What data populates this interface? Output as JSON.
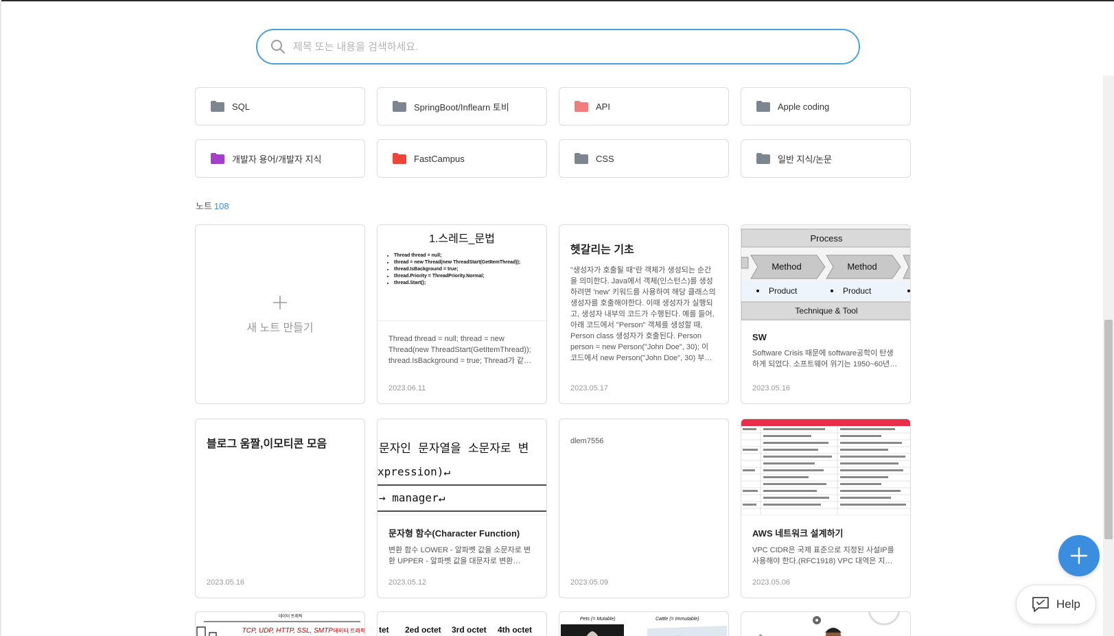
{
  "search": {
    "placeholder": "제목 또는 내용을 검색하세요."
  },
  "folders": [
    {
      "name": "SQL",
      "color": "#7d8590"
    },
    {
      "name": "SpringBoot/Inflearn 토비",
      "color": "#7d8590"
    },
    {
      "name": "API",
      "color": "#f07c7c"
    },
    {
      "name": "Apple coding",
      "color": "#7d8590"
    },
    {
      "name": "개발자 용어/개발자 지식",
      "color": "#a33fc9"
    },
    {
      "name": "FastCampus",
      "color": "#f0433a"
    },
    {
      "name": "CSS",
      "color": "#7d8590"
    },
    {
      "name": "일반 지식/논문",
      "color": "#7d8590"
    }
  ],
  "notes_header": {
    "label": "노트",
    "count": "108"
  },
  "new_note": {
    "label": "새 노트 만들기"
  },
  "notes": [
    {
      "thumb_title": "1.스레드_문법",
      "thumb_lines": [
        "Thread thread = null;",
        "thread = new Thread(new ThreadStart(GetItemThread));",
        "thread.IsBackground = true;",
        "thread.Priority = ThreadPriority.Normal;",
        "thread.Start();"
      ],
      "body": "Thread thread = null; thread = new Thread(new ThreadStart(GetItemThread)); thread.IsBackground = true; Thread가 같은 프로세스 내에서 동작하도록 하는 구문이다.",
      "date": "2023.06.11"
    },
    {
      "title": "헷갈리는 기초",
      "body": "\"생성자가 호출될 때\"란 객체가 생성되는 순간을 의미한다. Java에서 객체(인스턴스)를 생성하려면 'new' 키워드를 사용하여 해당 클래스의 생성자를 호출해야한다. 이때 생성자가 실행되고, 생성자 내부의 코드가 수행된다.  예를 들어, 아래 코드에서 \"Person\" 객체를 생성할 때, Person class 생성자가 호출된다.  Person person = new Person(\"John Doe\", 30); 이 코드에서 new Person(\"John Doe\", 30) 부분은 Person 클래스의 생성자를 호출하면서 인자로 \"John Doe\"와 30을 전달한다.",
      "date": "2023.05.17"
    },
    {
      "thumb": {
        "header": "Process",
        "method1": "Method",
        "method2": "Method",
        "product1": "Product",
        "product2": "Product",
        "footer": "Technique & Tool"
      },
      "title": "SW",
      "body": "Software Crisis 때문에 software공학이 탄생하게 되었다. 소프트웨어 위기는 1950~60년대까지 하드웨어 중심으로 발전해 왔다.",
      "date": "2023.05.16"
    },
    {
      "title": "블로그 움짤,이모티콘 모음",
      "date": "2023.05.16"
    },
    {
      "thumb": {
        "line1": "문자인 문자열을 소문자로 변",
        "line2": "xpression)↵",
        "line3": "→ manager↵"
      },
      "title": "문자형 함수(Character Function)",
      "body": " 변환 함수  LOWER  - 알파벳 값을 소문자로 변환 UPPER - 알파벳 값을 대문자로 변환 INITCAP - 알파벳 첫 글자만 대문자로 변환",
      "date": "2023.05.12"
    },
    {
      "body": "dlem7556",
      "date": "2023.05.09"
    },
    {
      "title": "AWS 네트워크 설계하기",
      "body": "  VPC CIDR은 국제 표준으로 지정된 사설IP를 사용해야 한다.(RFC1918) VPC 대역은 지속적으로 확장될 수 있으므로 넉넉하게 설정한다.",
      "date": "2023.05.06"
    }
  ],
  "partial_row": [
    {
      "label1": "데이터 트래픽",
      "label2": "TCP, UDP, HTTP, SSL, SMTP ···",
      "label3": "데이터 트래픽"
    },
    {
      "o1": "tet",
      "o2": "2ed octet",
      "o3": "3rd octet",
      "o4": "4th octet"
    },
    {
      "a": "Pets (= Mutable)",
      "b": "Cattle (= Immutable)"
    },
    {}
  ],
  "help": {
    "label": "Help"
  },
  "accent": "#3b8de0"
}
